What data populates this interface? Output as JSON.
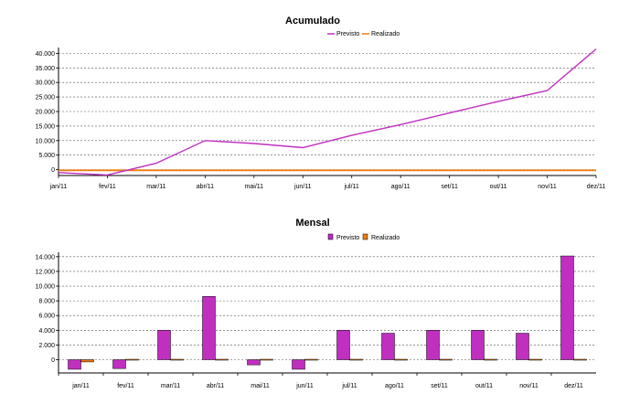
{
  "chart_data": [
    {
      "type": "line",
      "title": "Acumulado",
      "categories": [
        "jan/11",
        "fev/11",
        "mar/11",
        "abr/11",
        "mai/11",
        "jun/11",
        "jul/11",
        "ago/11",
        "set/11",
        "out/11",
        "nov/11",
        "dez/11"
      ],
      "series": [
        {
          "name": "Previsto",
          "color": "#c02fc0",
          "values": [
            -1000,
            -1800,
            2200,
            10000,
            9000,
            7600,
            11800,
            15500,
            19500,
            23500,
            27200,
            41500
          ]
        },
        {
          "name": "Realizado",
          "color": "#f07a10",
          "values": [
            -200,
            -200,
            -200,
            -200,
            -200,
            -200,
            -200,
            -200,
            -200,
            -200,
            -200,
            -200
          ]
        }
      ],
      "ylim": [
        -2000,
        42000
      ],
      "yticks": [
        "0",
        "5.000",
        "10.000",
        "15.000",
        "20.000",
        "25.000",
        "30.000",
        "35.000",
        "40.000"
      ],
      "ytick_values": [
        0,
        5000,
        10000,
        15000,
        20000,
        25000,
        30000,
        35000,
        40000
      ],
      "legend": "top-center",
      "grid": true
    },
    {
      "type": "bar",
      "title": "Mensal",
      "categories": [
        "jan/11",
        "fev/11",
        "mar/11",
        "abr/11",
        "mai/11",
        "jun/11",
        "jul/11",
        "ago/11",
        "set/11",
        "out/11",
        "nov/11",
        "dez/11"
      ],
      "series": [
        {
          "name": "Previsto",
          "color": "#c02fc0",
          "values": [
            -1300,
            -1200,
            4000,
            8600,
            -700,
            -1300,
            4000,
            3600,
            4000,
            4000,
            3600,
            14100
          ]
        },
        {
          "name": "Realizado",
          "color": "#f07a10",
          "values": [
            -300,
            0,
            0,
            0,
            0,
            0,
            0,
            0,
            0,
            0,
            0,
            0
          ]
        }
      ],
      "ylim": [
        -1800,
        14600
      ],
      "yticks": [
        "0",
        "2.000",
        "4.000",
        "6.000",
        "8.000",
        "10.000",
        "12.000",
        "14.000"
      ],
      "ytick_values": [
        0,
        2000,
        4000,
        6000,
        8000,
        10000,
        12000,
        14000
      ],
      "legend": "top-center",
      "grid": true
    }
  ]
}
